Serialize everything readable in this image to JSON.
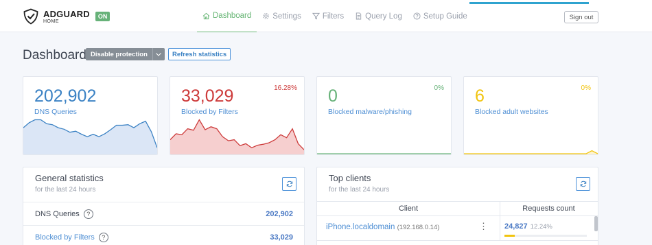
{
  "header": {
    "brand": "ADGUARD",
    "brand_sub": "HOME",
    "status_badge": "ON",
    "nav": [
      {
        "label": "Dashboard",
        "icon": "home-icon",
        "active": true
      },
      {
        "label": "Settings",
        "icon": "gear-icon",
        "active": false
      },
      {
        "label": "Filters",
        "icon": "filter-icon",
        "active": false
      },
      {
        "label": "Query Log",
        "icon": "document-icon",
        "active": false
      },
      {
        "label": "Setup Guide",
        "icon": "help-circle-icon",
        "active": false
      }
    ],
    "sign_out": "Sign out"
  },
  "dashboard": {
    "title": "Dashboard",
    "disable_button": "Disable protection",
    "refresh_button": "Refresh statistics"
  },
  "stats": [
    {
      "value": "202,902",
      "label": "DNS Queries",
      "percent": "",
      "color": "#3b82c4",
      "fill": "#dbe6f6"
    },
    {
      "value": "33,029",
      "label": "Blocked by Filters",
      "percent": "16.28%",
      "color": "#cd3a3a",
      "fill": "#f6cfcf"
    },
    {
      "value": "0",
      "label": "Blocked malware/phishing",
      "percent": "0%",
      "color": "#67b279",
      "fill": "#ffffff"
    },
    {
      "value": "6",
      "label": "Blocked adult websites",
      "percent": "0%",
      "color": "#f1c40f",
      "fill": "#fdf3cf"
    }
  ],
  "chart_data": [
    {
      "type": "area",
      "values": [
        52,
        62,
        68,
        68,
        60,
        58,
        52,
        49,
        43,
        45,
        39,
        34,
        39,
        34,
        40,
        48,
        57,
        57,
        58,
        52,
        60,
        65,
        44,
        12
      ]
    },
    {
      "type": "area",
      "values": [
        28,
        40,
        38,
        50,
        47,
        68,
        48,
        54,
        50,
        34,
        26,
        28,
        16,
        20,
        12,
        17,
        19,
        22,
        28,
        38,
        32,
        50,
        20,
        8
      ]
    },
    {
      "type": "area",
      "values": [
        0,
        0,
        0,
        0,
        0,
        0,
        0,
        0,
        0,
        0,
        0,
        0,
        0,
        0,
        0,
        0,
        0,
        0,
        0,
        0,
        0,
        0,
        0,
        0
      ]
    },
    {
      "type": "area",
      "values": [
        0,
        0,
        0,
        0,
        0,
        0,
        0,
        0,
        0,
        0,
        0,
        0,
        0,
        0,
        0,
        0,
        0,
        0,
        0,
        0,
        0,
        0,
        6,
        0
      ]
    }
  ],
  "general": {
    "title": "General statistics",
    "subtitle": "for the last 24 hours",
    "rows": [
      {
        "label": "DNS Queries",
        "value": "202,902"
      },
      {
        "label": "Blocked by Filters",
        "value": "33,029"
      }
    ]
  },
  "top_clients": {
    "title": "Top clients",
    "subtitle": "for the last 24 hours",
    "col_client": "Client",
    "col_requests": "Requests count",
    "rows": [
      {
        "name": "iPhone.localdomain",
        "ip": "(192.168.0.14)",
        "count": "24,827",
        "percent": "12.24%",
        "ratio": 0.1224
      }
    ]
  }
}
